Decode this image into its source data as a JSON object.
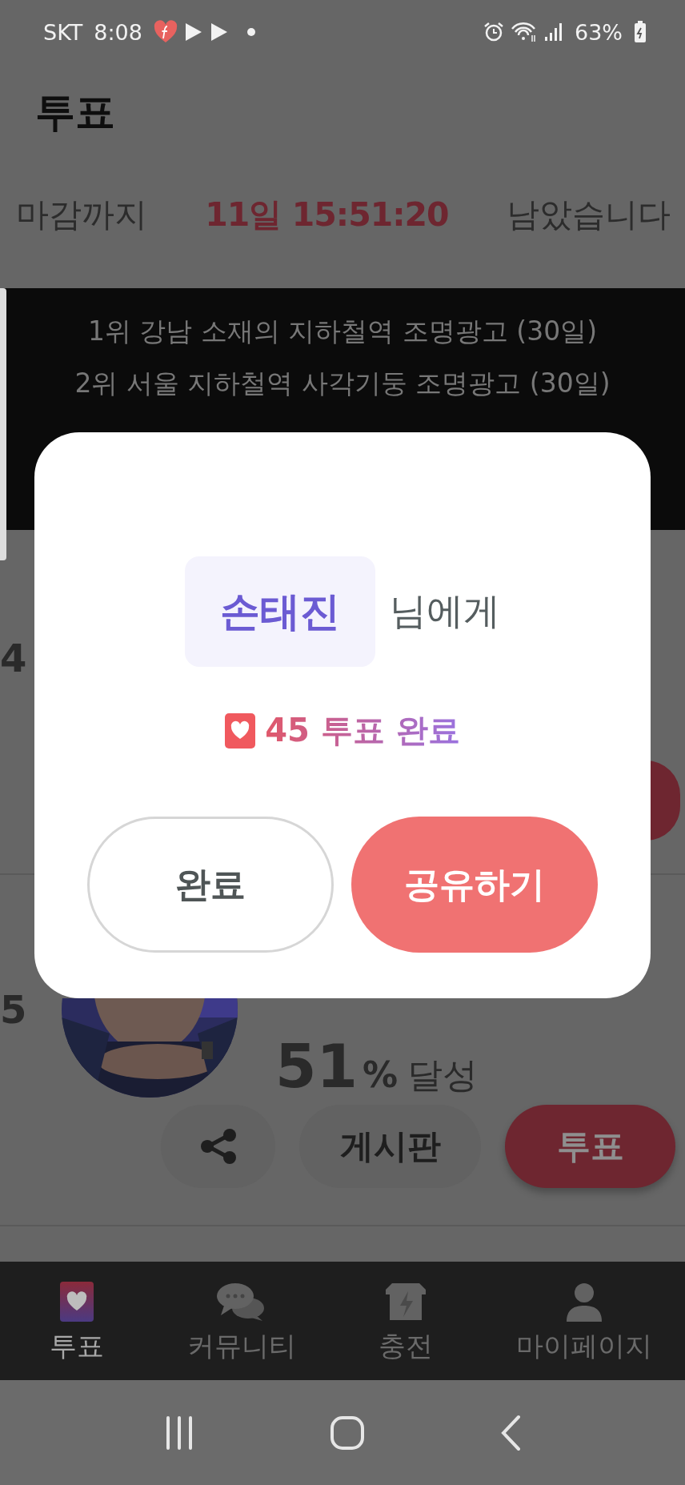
{
  "status_bar": {
    "carrier": "SKT",
    "time": "8:08",
    "battery": "63%"
  },
  "header": {
    "title": "투표"
  },
  "countdown": {
    "prefix": "마감까지",
    "remaining": "11일 15:51:20",
    "suffix": "남았습니다"
  },
  "banner": {
    "lines": [
      "1위 강남 소재의 지하철역 조명광고 (30일)",
      "2위 서울 지하철역 사각기둥 조명광고 (30일)"
    ]
  },
  "rows": [
    {
      "rank": "4",
      "kind": "covered"
    },
    {
      "rank": "5",
      "kind": "full",
      "percent": "51",
      "percent_unit": "%",
      "percent_label": "달성",
      "board_button": "게시판",
      "vote_button": "투표"
    }
  ],
  "dialog": {
    "name": "손태진",
    "name_suffix": "님에게",
    "result": "45 투표 완료",
    "buttons": [
      {
        "label": "완료",
        "kind": "secondary"
      },
      {
        "label": "공유하기",
        "kind": "primary"
      }
    ]
  },
  "bottom_nav": [
    {
      "label": "투표",
      "kind": "vote",
      "selected": true
    },
    {
      "label": "커뮤니티",
      "kind": "community",
      "selected": false
    },
    {
      "label": "충전",
      "kind": "charge",
      "selected": false
    },
    {
      "label": "마이페이지",
      "kind": "mypage",
      "selected": false
    }
  ]
}
